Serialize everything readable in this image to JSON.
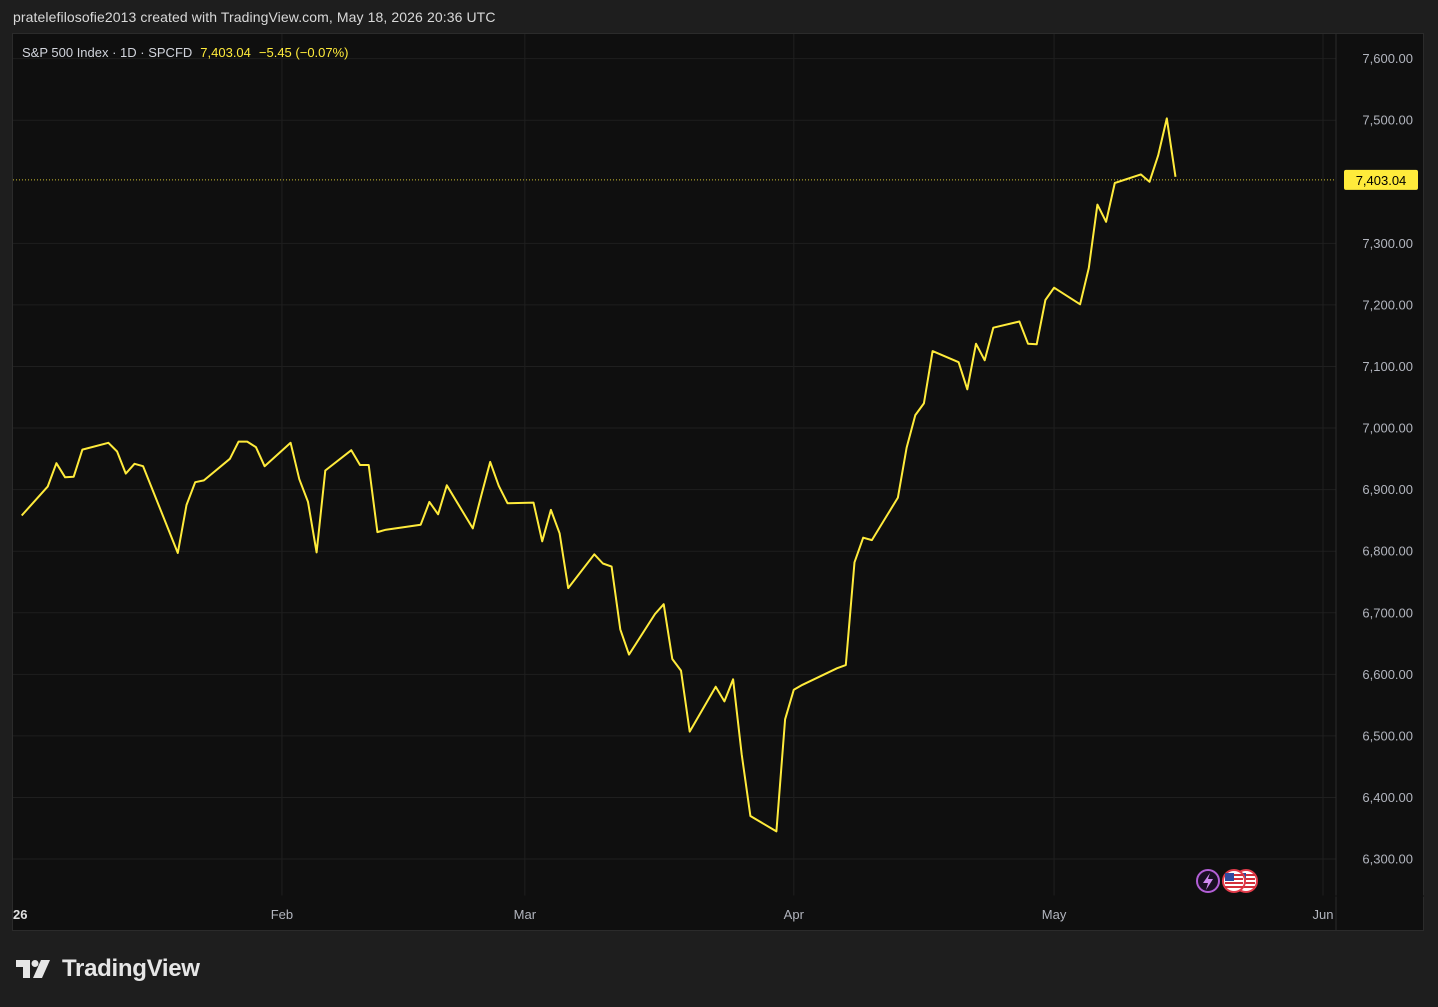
{
  "header": {
    "text": "pratelefilosofie2013 created with TradingView.com, May 18, 2026 20:36 UTC"
  },
  "legend": {
    "symbol": "S&P 500 Index · 1D · SPCFD",
    "last": "7,403.04",
    "change": "−5.45 (−0.07%)"
  },
  "price_badge": "7,403.04",
  "footer": {
    "brand": "TradingView"
  },
  "colors": {
    "line": "#ffeb3b",
    "background": "#0f0f0f",
    "grid": "#1f1f1f",
    "axis_text": "#b2b5be"
  },
  "chart_data": {
    "type": "line",
    "title": "",
    "xlabel": "",
    "ylabel": "",
    "ylim": [
      6240,
      7640
    ],
    "grid": true,
    "last_value": 7403.04,
    "y_ticks": [
      6300,
      6400,
      6500,
      6600,
      6700,
      6800,
      6900,
      7000,
      7100,
      7200,
      7300,
      7400,
      7500,
      7600
    ],
    "y_tick_labels": [
      "6,300.00",
      "6,400.00",
      "6,500.00",
      "6,600.00",
      "6,700.00",
      "6,800.00",
      "6,900.00",
      "7,000.00",
      "7,100.00",
      "7,200.00",
      "7,300.00",
      "7,403.04",
      "7,500.00",
      "7,600.00"
    ],
    "x_ticks": [
      {
        "label": "26",
        "date": "2026-01-01"
      },
      {
        "label": "Feb",
        "date": "2026-02-01"
      },
      {
        "label": "Mar",
        "date": "2026-03-01"
      },
      {
        "label": "Apr",
        "date": "2026-04-01"
      },
      {
        "label": "May",
        "date": "2026-05-01"
      },
      {
        "label": "Jun",
        "date": "2026-06-01"
      }
    ],
    "x": [
      "2026-01-02",
      "2026-01-05",
      "2026-01-06",
      "2026-01-07",
      "2026-01-08",
      "2026-01-09",
      "2026-01-12",
      "2026-01-13",
      "2026-01-14",
      "2026-01-15",
      "2026-01-16",
      "2026-01-20",
      "2026-01-21",
      "2026-01-22",
      "2026-01-23",
      "2026-01-26",
      "2026-01-27",
      "2026-01-28",
      "2026-01-29",
      "2026-01-30",
      "2026-02-02",
      "2026-02-03",
      "2026-02-04",
      "2026-02-05",
      "2026-02-06",
      "2026-02-09",
      "2026-02-10",
      "2026-02-11",
      "2026-02-12",
      "2026-02-13",
      "2026-02-17",
      "2026-02-18",
      "2026-02-19",
      "2026-02-20",
      "2026-02-23",
      "2026-02-24",
      "2026-02-25",
      "2026-02-26",
      "2026-02-27",
      "2026-03-02",
      "2026-03-03",
      "2026-03-04",
      "2026-03-05",
      "2026-03-06",
      "2026-03-09",
      "2026-03-10",
      "2026-03-11",
      "2026-03-12",
      "2026-03-13",
      "2026-03-16",
      "2026-03-17",
      "2026-03-18",
      "2026-03-19",
      "2026-03-20",
      "2026-03-23",
      "2026-03-24",
      "2026-03-25",
      "2026-03-26",
      "2026-03-27",
      "2026-03-30",
      "2026-03-31",
      "2026-04-01",
      "2026-04-02",
      "2026-04-06",
      "2026-04-07",
      "2026-04-08",
      "2026-04-09",
      "2026-04-10",
      "2026-04-13",
      "2026-04-14",
      "2026-04-15",
      "2026-04-16",
      "2026-04-17",
      "2026-04-20",
      "2026-04-21",
      "2026-04-22",
      "2026-04-23",
      "2026-04-24",
      "2026-04-27",
      "2026-04-28",
      "2026-04-29",
      "2026-04-30",
      "2026-05-01",
      "2026-05-04",
      "2026-05-05",
      "2026-05-06",
      "2026-05-07",
      "2026-05-08",
      "2026-05-11",
      "2026-05-12",
      "2026-05-13",
      "2026-05-14",
      "2026-05-15"
    ],
    "series": [
      {
        "values": [
          6858,
          6905,
          6943,
          6920,
          6921,
          6965,
          6976,
          6962,
          6926,
          6942,
          6938,
          6797,
          6875,
          6912,
          6915,
          6950,
          6978,
          6978,
          6969,
          6938,
          6976,
          6917,
          6880,
          6798,
          6931,
          6964,
          6940,
          6940,
          6831,
          6835,
          6843,
          6880,
          6860,
          6907,
          6837,
          6892,
          6945,
          6906,
          6878,
          6879,
          6816,
          6867,
          6829,
          6740,
          6795,
          6780,
          6775,
          6673,
          6632,
          6698,
          6714,
          6625,
          6606,
          6507,
          6580,
          6556,
          6592,
          6470,
          6370,
          6345,
          6527,
          6575,
          6583,
          6610,
          6615,
          6782,
          6822,
          6818,
          6887,
          6968,
          7021,
          7040,
          7125,
          7107,
          7063,
          7137,
          7110,
          7163,
          7173,
          7137,
          7136,
          7208,
          7228,
          7201,
          7260,
          7363,
          7335,
          7398,
          7412,
          7400,
          7443,
          7503,
          7408,
          7403.04
        ]
      }
    ]
  }
}
